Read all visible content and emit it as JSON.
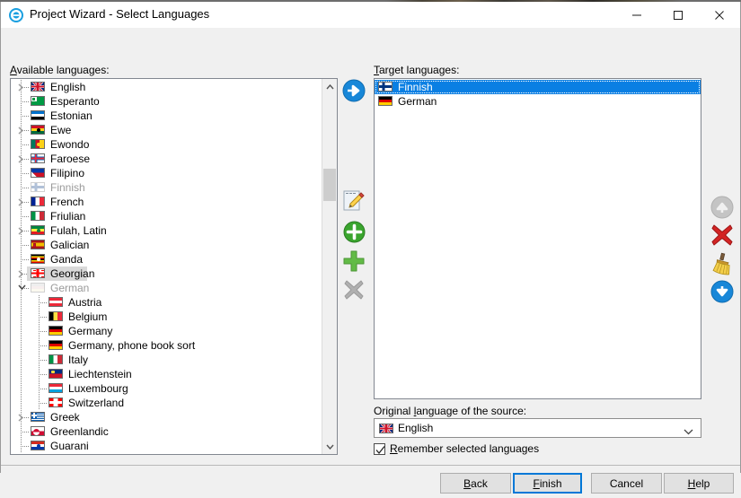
{
  "window": {
    "title": "Project Wizard - Select Languages",
    "app_icon": "circle-dialog-icon",
    "minimize_label": "Minimize",
    "maximize_label": "Maximize",
    "close_label": "Close"
  },
  "available": {
    "label_prefix": "A",
    "label_rest": "vailable languages:",
    "items": [
      {
        "name": "English",
        "depth": 0,
        "expander": "collapsed",
        "state": "normal",
        "flag": "gb"
      },
      {
        "name": "Esperanto",
        "depth": 0,
        "expander": "none",
        "state": "normal",
        "flag": "eo"
      },
      {
        "name": "Estonian",
        "depth": 0,
        "expander": "none",
        "state": "normal",
        "flag": "ee"
      },
      {
        "name": "Ewe",
        "depth": 0,
        "expander": "collapsed",
        "state": "normal",
        "flag": "gh"
      },
      {
        "name": "Ewondo",
        "depth": 0,
        "expander": "none",
        "state": "normal",
        "flag": "cm"
      },
      {
        "name": "Faroese",
        "depth": 0,
        "expander": "collapsed",
        "state": "normal",
        "flag": "fo"
      },
      {
        "name": "Filipino",
        "depth": 0,
        "expander": "none",
        "state": "normal",
        "flag": "ph"
      },
      {
        "name": "Finnish",
        "depth": 0,
        "expander": "none",
        "state": "disabled",
        "flag": "fi"
      },
      {
        "name": "French",
        "depth": 0,
        "expander": "collapsed",
        "state": "normal",
        "flag": "fr"
      },
      {
        "name": "Friulian",
        "depth": 0,
        "expander": "none",
        "state": "normal",
        "flag": "it"
      },
      {
        "name": "Fulah, Latin",
        "depth": 0,
        "expander": "collapsed",
        "state": "normal",
        "flag": "sn"
      },
      {
        "name": "Galician",
        "depth": 0,
        "expander": "none",
        "state": "normal",
        "flag": "es"
      },
      {
        "name": "Ganda",
        "depth": 0,
        "expander": "none",
        "state": "normal",
        "flag": "ug"
      },
      {
        "name": "Georgian",
        "depth": 0,
        "expander": "collapsed",
        "state": "selected-inactive",
        "flag": "ge"
      },
      {
        "name": "German",
        "depth": 0,
        "expander": "expanded",
        "state": "disabled",
        "flag": "de-faded"
      },
      {
        "name": "Austria",
        "depth": 1,
        "expander": "none",
        "state": "normal",
        "flag": "at"
      },
      {
        "name": "Belgium",
        "depth": 1,
        "expander": "none",
        "state": "normal",
        "flag": "be"
      },
      {
        "name": "Germany",
        "depth": 1,
        "expander": "none",
        "state": "normal",
        "flag": "de"
      },
      {
        "name": "Germany, phone book sort",
        "depth": 1,
        "expander": "none",
        "state": "normal",
        "flag": "de"
      },
      {
        "name": "Italy",
        "depth": 1,
        "expander": "none",
        "state": "normal",
        "flag": "it"
      },
      {
        "name": "Liechtenstein",
        "depth": 1,
        "expander": "none",
        "state": "normal",
        "flag": "li"
      },
      {
        "name": "Luxembourg",
        "depth": 1,
        "expander": "none",
        "state": "normal",
        "flag": "lu"
      },
      {
        "name": "Switzerland",
        "depth": 1,
        "expander": "none",
        "state": "normal",
        "flag": "ch"
      },
      {
        "name": "Greek",
        "depth": 0,
        "expander": "collapsed",
        "state": "normal",
        "flag": "gr"
      },
      {
        "name": "Greenlandic",
        "depth": 0,
        "expander": "none",
        "state": "normal",
        "flag": "gl"
      },
      {
        "name": "Guarani",
        "depth": 0,
        "expander": "none",
        "state": "normal",
        "flag": "py"
      }
    ],
    "scrollbar": {
      "up_arrow": "chevron-up-icon",
      "down_arrow": "chevron-down-icon"
    }
  },
  "target": {
    "label_prefix": "T",
    "label_rest": "arget languages:",
    "items": [
      {
        "name": "Finnish",
        "state": "selected",
        "flag": "fi"
      },
      {
        "name": "German",
        "state": "normal",
        "flag": "de"
      }
    ]
  },
  "middle_buttons": [
    {
      "icon": "blue-right-arrow-icon",
      "name": "add-to-target-button",
      "enabled": true
    },
    {
      "icon": "pencil-edit-icon",
      "name": "edit-language-button",
      "enabled": true
    },
    {
      "icon": "green-circle-plus-icon",
      "name": "new-language-button",
      "enabled": true
    },
    {
      "icon": "green-plus-icon",
      "name": "add-language-button",
      "enabled": true
    },
    {
      "icon": "grey-x-icon",
      "name": "delete-language-button",
      "enabled": false
    }
  ],
  "right_buttons": [
    {
      "icon": "grey-up-arrow-icon",
      "name": "move-up-button",
      "enabled": false
    },
    {
      "icon": "red-x-icon",
      "name": "remove-target-button",
      "enabled": true
    },
    {
      "icon": "broom-icon",
      "name": "clear-targets-button",
      "enabled": true
    },
    {
      "icon": "blue-down-arrow-icon",
      "name": "move-down-button",
      "enabled": true
    }
  ],
  "original_language": {
    "label_prefix": "Original ",
    "label_accel": "l",
    "label_rest": "anguage of the source:",
    "value": "English",
    "flag": "gb",
    "dropdown_icon": "chevron-down-icon"
  },
  "remember": {
    "checked": true,
    "label_prefix": "R",
    "label_rest": "emember selected languages"
  },
  "footer": {
    "back": {
      "prefix": "",
      "accel": "B",
      "rest": "ack"
    },
    "finish": {
      "prefix": "",
      "accel": "F",
      "rest": "inish",
      "default": true
    },
    "cancel": {
      "prefix": "Cancel",
      "accel": "",
      "rest": ""
    },
    "help": {
      "prefix": "",
      "accel": "H",
      "rest": "elp"
    }
  },
  "colors": {
    "accent": "#0078d7",
    "selection": "#0a7fe3",
    "selection_inactive": "#d9d9d9",
    "dialog_bg": "#f0f0f0",
    "disabled_text": "#9a9a9a"
  }
}
